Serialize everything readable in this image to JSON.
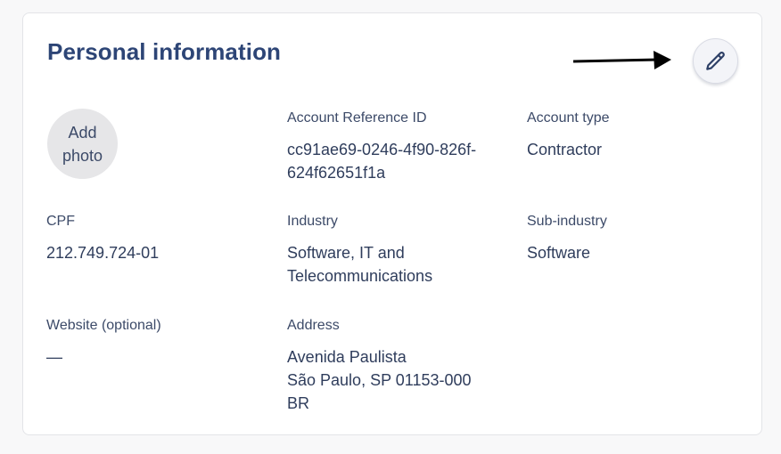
{
  "section": {
    "title": "Personal information",
    "edit_icon": "pencil-icon",
    "annotation_arrow_icon": "arrow-right-icon"
  },
  "avatar": {
    "label": "Add\nphoto"
  },
  "fields": {
    "account_reference_id": {
      "label": "Account Reference ID",
      "value": "cc91ae69-0246-4f90-826f-\n624f62651f1a"
    },
    "account_type": {
      "label": "Account type",
      "value": "Contractor"
    },
    "cpf": {
      "label": "CPF",
      "value": "212.749.724-01"
    },
    "industry": {
      "label": "Industry",
      "value": "Software, IT and\nTelecommunications"
    },
    "sub_industry": {
      "label": "Sub-industry",
      "value": "Software"
    },
    "website": {
      "label": "Website (optional)",
      "value": "—"
    },
    "address": {
      "label": "Address",
      "value": "Avenida Paulista\nSão Paulo, SP 01153-000\nBR"
    }
  },
  "colors": {
    "title": "#2d4576",
    "text": "#2f3d5c",
    "avatar_bg": "#e6e6e8",
    "card_border": "#e3e4e8"
  }
}
